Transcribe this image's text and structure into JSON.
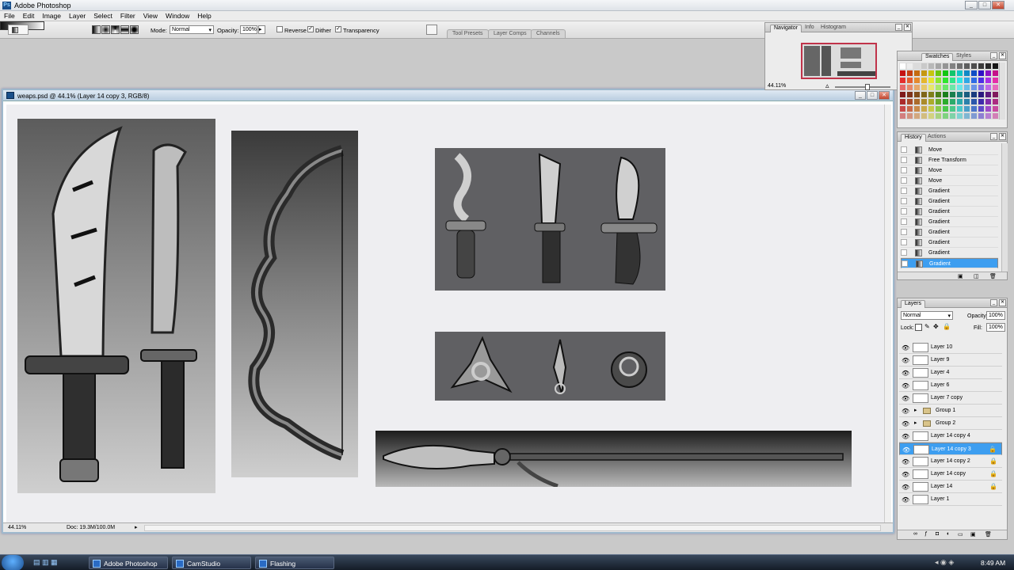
{
  "app": {
    "title": "Adobe Photoshop",
    "menu": [
      "File",
      "Edit",
      "Image",
      "Layer",
      "Select",
      "Filter",
      "View",
      "Window",
      "Help"
    ]
  },
  "options_bar": {
    "mode_label": "Mode:",
    "mode_value": "Normal",
    "opacity_label": "Opacity:",
    "opacity_value": "100%",
    "reverse_label": "Reverse",
    "dither_label": "Dither",
    "transparency_label": "Transparency",
    "dock_tabs": [
      "Tool Presets",
      "Layer Comps",
      "Channels"
    ]
  },
  "document": {
    "title": "weaps.psd @ 44.1% (Layer 14 copy 3, RGB/8)",
    "zoom": "44.11%",
    "doc_info": "Doc: 19.3M/100.0M"
  },
  "navigator": {
    "tabs": [
      "Navigator",
      "Info",
      "Histogram"
    ],
    "zoom": "44.11%"
  },
  "swatches": {
    "tabs": [
      "Swatches",
      "Styles"
    ]
  },
  "history": {
    "tabs": [
      "History",
      "Actions"
    ],
    "items": [
      "Move",
      "Free Transform",
      "Move",
      "Move",
      "Gradient",
      "Gradient",
      "Gradient",
      "Gradient",
      "Gradient",
      "Gradient",
      "Gradient",
      "Gradient"
    ],
    "selected_index": 11
  },
  "layers": {
    "tab": "Layers",
    "blend_mode": "Normal",
    "opacity_label": "Opacity:",
    "opacity_value": "100%",
    "lock_label": "Lock:",
    "fill_label": "Fill:",
    "fill_value": "100%",
    "items": [
      {
        "name": "Layer 10",
        "locked": false,
        "group": false
      },
      {
        "name": "Layer 9",
        "locked": false,
        "group": false
      },
      {
        "name": "Layer 4",
        "locked": false,
        "group": false
      },
      {
        "name": "Layer 6",
        "locked": false,
        "group": false
      },
      {
        "name": "Layer 7 copy",
        "locked": false,
        "group": false
      },
      {
        "name": "Group 1",
        "locked": false,
        "group": true
      },
      {
        "name": "Group 2",
        "locked": false,
        "group": true
      },
      {
        "name": "Layer 14 copy 4",
        "locked": false,
        "group": false
      },
      {
        "name": "Layer 14 copy 3",
        "locked": true,
        "group": false
      },
      {
        "name": "Layer 14 copy 2",
        "locked": true,
        "group": false
      },
      {
        "name": "Layer 14 copy",
        "locked": true,
        "group": false
      },
      {
        "name": "Layer 14",
        "locked": true,
        "group": false
      },
      {
        "name": "Layer 1",
        "locked": false,
        "group": false
      }
    ],
    "selected_index": 8
  },
  "taskbar": {
    "items": [
      "Adobe Photoshop",
      "CamStudio",
      "Flashing"
    ],
    "clock": "8:49 AM"
  },
  "colors": {
    "selection": "#3d9ef0",
    "taskbar": "#1e2938"
  }
}
